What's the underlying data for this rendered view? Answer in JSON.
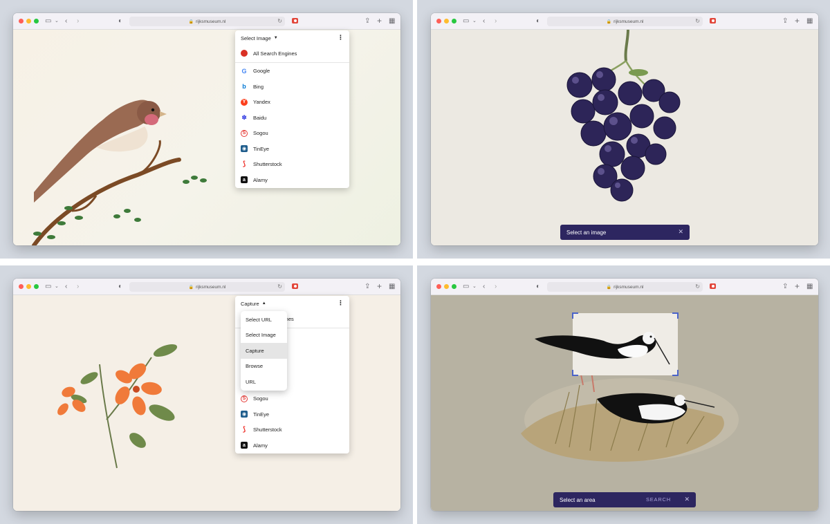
{
  "browser": {
    "url": "rijksmuseum.nl"
  },
  "panel1": {
    "menu_title": "Select Image",
    "engines": [
      {
        "label": "All Search Engines",
        "icon": "globe-icon",
        "color": "#d93025"
      },
      {
        "label": "Google",
        "icon": "google-icon",
        "color": "#4285f4"
      },
      {
        "label": "Bing",
        "icon": "bing-icon",
        "color": "#0078d4"
      },
      {
        "label": "Yandex",
        "icon": "yandex-icon",
        "color": "#fc3f1d"
      },
      {
        "label": "Baidu",
        "icon": "baidu-icon",
        "color": "#2932e1"
      },
      {
        "label": "Sogou",
        "icon": "sogou-icon",
        "color": "#e53935"
      },
      {
        "label": "TinEye",
        "icon": "tineye-icon",
        "color": "#1f5d8c"
      },
      {
        "label": "Shutterstock",
        "icon": "shutterstock-icon",
        "color": "#ee2b24"
      },
      {
        "label": "Alamy",
        "icon": "alamy-icon",
        "color": "#111111"
      }
    ]
  },
  "panel2": {
    "bar_text": "Select an image"
  },
  "panel3": {
    "menu_title": "Capture",
    "partial_row": "ines",
    "modes": [
      "Select URL",
      "Select Image",
      "Capture",
      "Browse",
      "URL"
    ],
    "selected_mode": "Capture",
    "engines": [
      {
        "label": "Sogou",
        "icon": "sogou-icon",
        "color": "#e53935"
      },
      {
        "label": "TinEye",
        "icon": "tineye-icon",
        "color": "#1f5d8c"
      },
      {
        "label": "Shutterstock",
        "icon": "shutterstock-icon",
        "color": "#ee2b24"
      },
      {
        "label": "Alamy",
        "icon": "alamy-icon",
        "color": "#111111"
      }
    ]
  },
  "panel4": {
    "bar_text": "Select an area",
    "search_label": "SEARCH"
  },
  "colors": {
    "accent": "#2d2660",
    "extension": "#e2463a"
  }
}
